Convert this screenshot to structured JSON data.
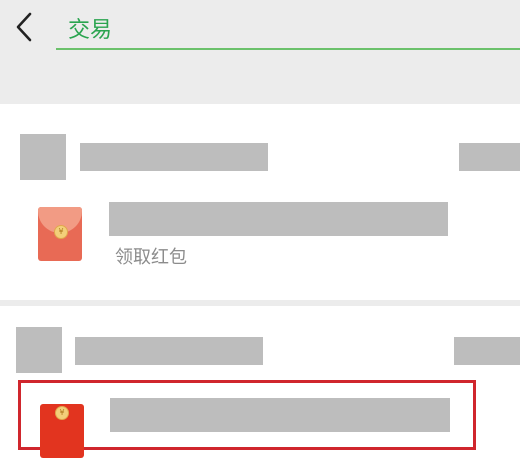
{
  "header": {
    "back_icon": "chevron-left-icon",
    "search": {
      "value": "交易"
    },
    "accent_color": "#6bc16b"
  },
  "feed": {
    "items": [
      {
        "redpacket_label": "领取红包",
        "redpacket_icon": "red-packet-icon",
        "coin_glyph": "¥"
      },
      {
        "coin_glyph": "¥",
        "highlight_color": "#d0262d"
      }
    ]
  }
}
